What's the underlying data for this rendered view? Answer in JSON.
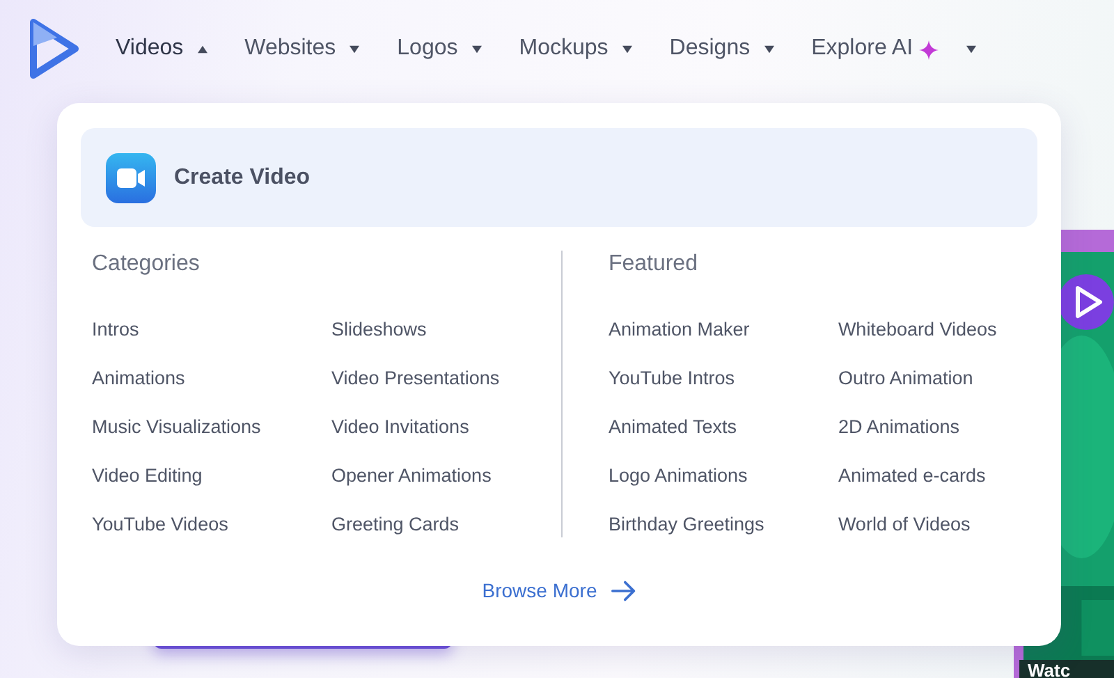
{
  "nav": {
    "items": [
      {
        "label": "Videos",
        "expanded": true,
        "sparkle": false
      },
      {
        "label": "Websites",
        "expanded": false,
        "sparkle": false
      },
      {
        "label": "Logos",
        "expanded": false,
        "sparkle": false
      },
      {
        "label": "Mockups",
        "expanded": false,
        "sparkle": false
      },
      {
        "label": "Designs",
        "expanded": false,
        "sparkle": false
      },
      {
        "label": "Explore AI",
        "expanded": false,
        "sparkle": true
      }
    ]
  },
  "dropdown": {
    "header": {
      "label": "Create Video"
    },
    "sections": [
      {
        "title": "Categories",
        "items": [
          "Intros",
          "Slideshows",
          "Animations",
          "Video Presentations",
          "Music Visualizations",
          "Video Invitations",
          "Video Editing",
          "Opener Animations",
          "YouTube Videos",
          "Greeting Cards"
        ]
      },
      {
        "title": "Featured",
        "items": [
          "Animation Maker",
          "Whiteboard Videos",
          "YouTube Intros",
          "Outro Animation",
          "Animated Texts",
          "2D Animations",
          "Logo Animations",
          "Animated e-cards",
          "Birthday Greetings",
          "World of Videos"
        ]
      }
    ],
    "footer_link": "Browse More"
  },
  "video_card": {
    "caption": "Watc"
  }
}
